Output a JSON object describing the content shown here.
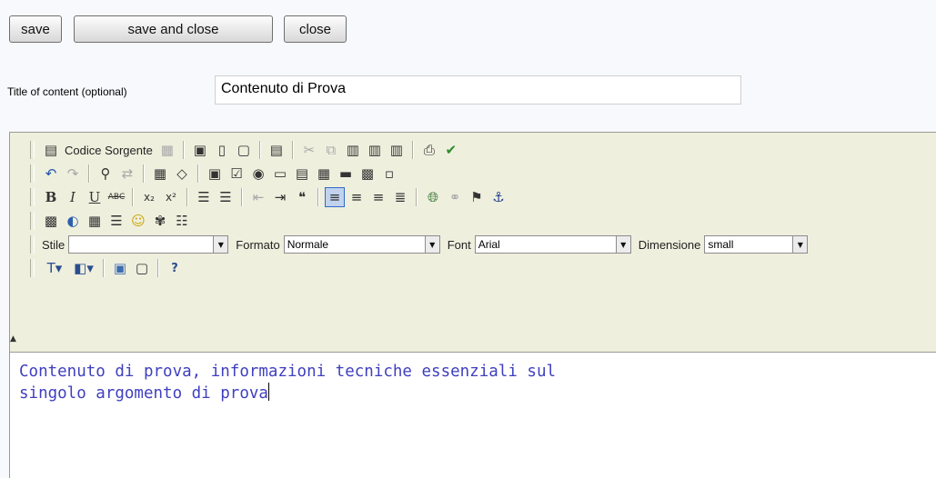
{
  "buttons": {
    "save": "save",
    "save_and_close": "save and close",
    "close": "close"
  },
  "title_field": {
    "label": "Title of content (optional)",
    "value": "Contenuto di Prova"
  },
  "toolbar": {
    "source_label": "Codice Sorgente",
    "style": {
      "label": "Stile",
      "value": ""
    },
    "format": {
      "label": "Formato",
      "value": "Normale"
    },
    "font": {
      "label": "Font",
      "value": "Arial"
    },
    "size": {
      "label": "Dimensione",
      "value": "small"
    }
  },
  "content": {
    "line1": "Contenuto di prova, informazioni tecniche essenziali sul",
    "line2": "singolo argomento di prova"
  },
  "colors": {
    "content_text": "#3f3fbf",
    "toolbar_bg": "#efefde",
    "active_button": "#c1d2ee"
  }
}
